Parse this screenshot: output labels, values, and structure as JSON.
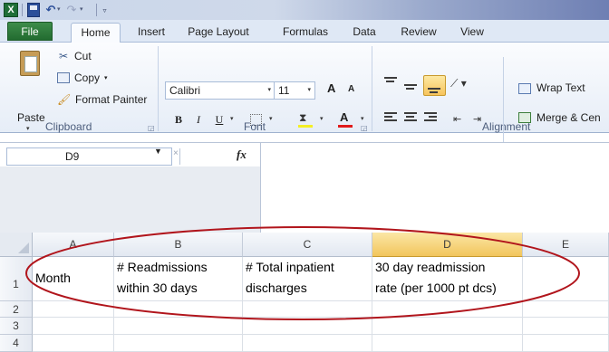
{
  "quick_access": {
    "excel_glyph": "X",
    "undo_glyph": "↶",
    "redo_glyph": "↷",
    "caret": "▾",
    "customize_glyph": "▿"
  },
  "tabs": [
    {
      "label": "File"
    },
    {
      "label": "Home"
    },
    {
      "label": "Insert"
    },
    {
      "label": "Page Layout"
    },
    {
      "label": "Formulas"
    },
    {
      "label": "Data"
    },
    {
      "label": "Review"
    },
    {
      "label": "View"
    }
  ],
  "clipboard": {
    "paste_label": "Paste",
    "cut_label": "Cut",
    "copy_label": "Copy",
    "format_painter_label": "Format Painter",
    "group_label": "Clipboard"
  },
  "font": {
    "font_name": "Calibri",
    "font_size": "11",
    "bold": "B",
    "italic": "I",
    "underline": "U",
    "grow_glyph": "A",
    "shrink_glyph": "A",
    "font_color_glyph": "A",
    "group_label": "Font",
    "fill_color": "#f4ef25",
    "font_color": "#e01b1b"
  },
  "alignment": {
    "wrap_text_label": "Wrap Text",
    "merge_label": "Merge & Cen",
    "group_label": "Alignment"
  },
  "formula_bar": {
    "name_box": "D9",
    "fx_label": "fx",
    "cancel_glyph": "×"
  },
  "sheet": {
    "columns": [
      {
        "name": "A"
      },
      {
        "name": "B"
      },
      {
        "name": "C"
      },
      {
        "name": "D",
        "selected": true
      },
      {
        "name": "E"
      }
    ],
    "rows": [
      "1",
      "2",
      "3",
      "4"
    ],
    "row1": {
      "A": [
        "Month"
      ],
      "B": [
        "# Readmissions",
        "within 30 days"
      ],
      "C": [
        "# Total inpatient",
        "discharges"
      ],
      "D": [
        "30 day readmission",
        "rate (per 1000 pt dcs)"
      ]
    }
  },
  "annotation_color": "#b1151c",
  "selected_header_color": "#f2c55c"
}
